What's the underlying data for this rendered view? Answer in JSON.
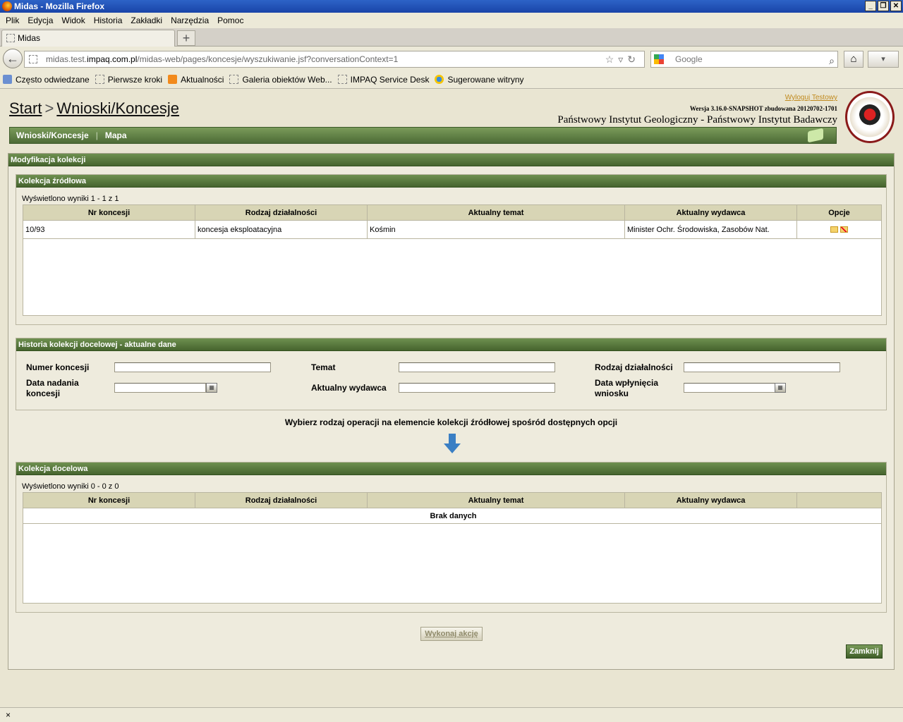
{
  "window": {
    "title": "Midas - Mozilla Firefox"
  },
  "menu": [
    "Plik",
    "Edycja",
    "Widok",
    "Historia",
    "Zakładki",
    "Narzędzia",
    "Pomoc"
  ],
  "tab": {
    "label": "Midas"
  },
  "url": {
    "prefix": "midas.test.",
    "domain": "impaq.com.pl",
    "path": "/midas-web/pages/koncesje/wyszukiwanie.jsf?conversationContext=1"
  },
  "search": {
    "placeholder": "Google"
  },
  "bookmarks": [
    "Często odwiedzane",
    "Pierwsze kroki",
    "Aktualności",
    "Galeria obiektów Web...",
    "IMPAQ Service Desk",
    "Sugerowane witryny"
  ],
  "header": {
    "crumb_start": "Start",
    "crumb_sep": ">",
    "crumb_current": "Wnioski/Koncesje",
    "logout": "Wyloguj Testowy",
    "version": "Wersja 3.16.0-SNAPSHOT zbudowana 20120702-1701",
    "institute": "Państwowy Instytut Geologiczny - Państwowy Instytut Badawczy"
  },
  "nav": {
    "item1": "Wnioski/Koncesje",
    "sep": "|",
    "item2": "Mapa"
  },
  "panel": {
    "title": "Modyfikacja kolekcji"
  },
  "source": {
    "title": "Kolekcja źródłowa",
    "results": "Wyświetlono wyniki 1 - 1 z 1",
    "columns": [
      "Nr koncesji",
      "Rodzaj działalności",
      "Aktualny temat",
      "Aktualny wydawca",
      "Opcje"
    ],
    "rows": [
      {
        "nr": "10/93",
        "rodzaj": "koncesja eksploatacyjna",
        "temat": "Kośmin",
        "wydawca": "Minister Ochr. Środowiska, Zasobów Nat."
      }
    ]
  },
  "history": {
    "title": "Historia kolekcji docelowej - aktualne dane",
    "numer_label": "Numer koncesji",
    "temat_label": "Temat",
    "rodzaj_label": "Rodzaj działalności",
    "data_nadania_label": "Data nadania koncesji",
    "wydawca_label": "Aktualny wydawca",
    "data_wplyniecia_label": "Data wpłynięcia wniosku",
    "numer_value": "",
    "temat_value": "",
    "rodzaj_value": "",
    "data_nadania_value": "",
    "wydawca_value": "",
    "data_wplyniecia_value": ""
  },
  "instruction": "Wybierz rodzaj operacji na elemencie kolekcji źródłowej spośród dostępnych opcji",
  "target": {
    "title": "Kolekcja docelowa",
    "results": "Wyświetlono wyniki 0 - 0 z 0",
    "columns": [
      "Nr koncesji",
      "Rodzaj działalności",
      "Aktualny temat",
      "Aktualny wydawca",
      ""
    ],
    "empty": "Brak danych"
  },
  "actions": {
    "execute": "Wykonaj akcję",
    "close": "Zamknij"
  },
  "status": {
    "close_glyph": "×"
  }
}
